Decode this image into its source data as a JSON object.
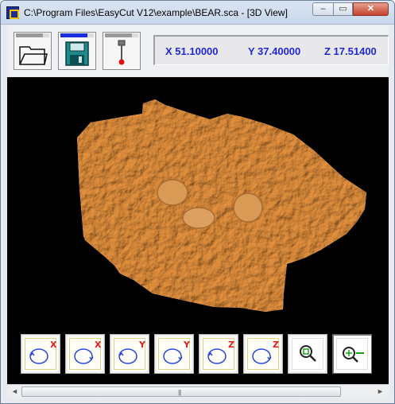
{
  "window": {
    "title": "C:\\Program Files\\EasyCut V12\\example\\BEAR.sca - [3D View]",
    "min_glyph": "–",
    "max_glyph": "▭",
    "close_glyph": "✕"
  },
  "coords": {
    "x": "X 51.10000",
    "y": "Y 37.40000",
    "z": "Z 17.51400"
  },
  "view_buttons": [
    {
      "axis": "X",
      "color": "#e02020"
    },
    {
      "axis": "X",
      "color": "#e02020"
    },
    {
      "axis": "Y",
      "color": "#e02020"
    },
    {
      "axis": "Y",
      "color": "#e02020"
    },
    {
      "axis": "Z",
      "color": "#e02020"
    },
    {
      "axis": "Z",
      "color": "#e02020"
    }
  ],
  "scrollbar": {
    "grip": "|||",
    "left_arrow": "◄",
    "right_arrow": "►"
  },
  "colors": {
    "model": "#e6ad68",
    "coords_text": "#2227d6",
    "viewport_bg": "#000000"
  }
}
